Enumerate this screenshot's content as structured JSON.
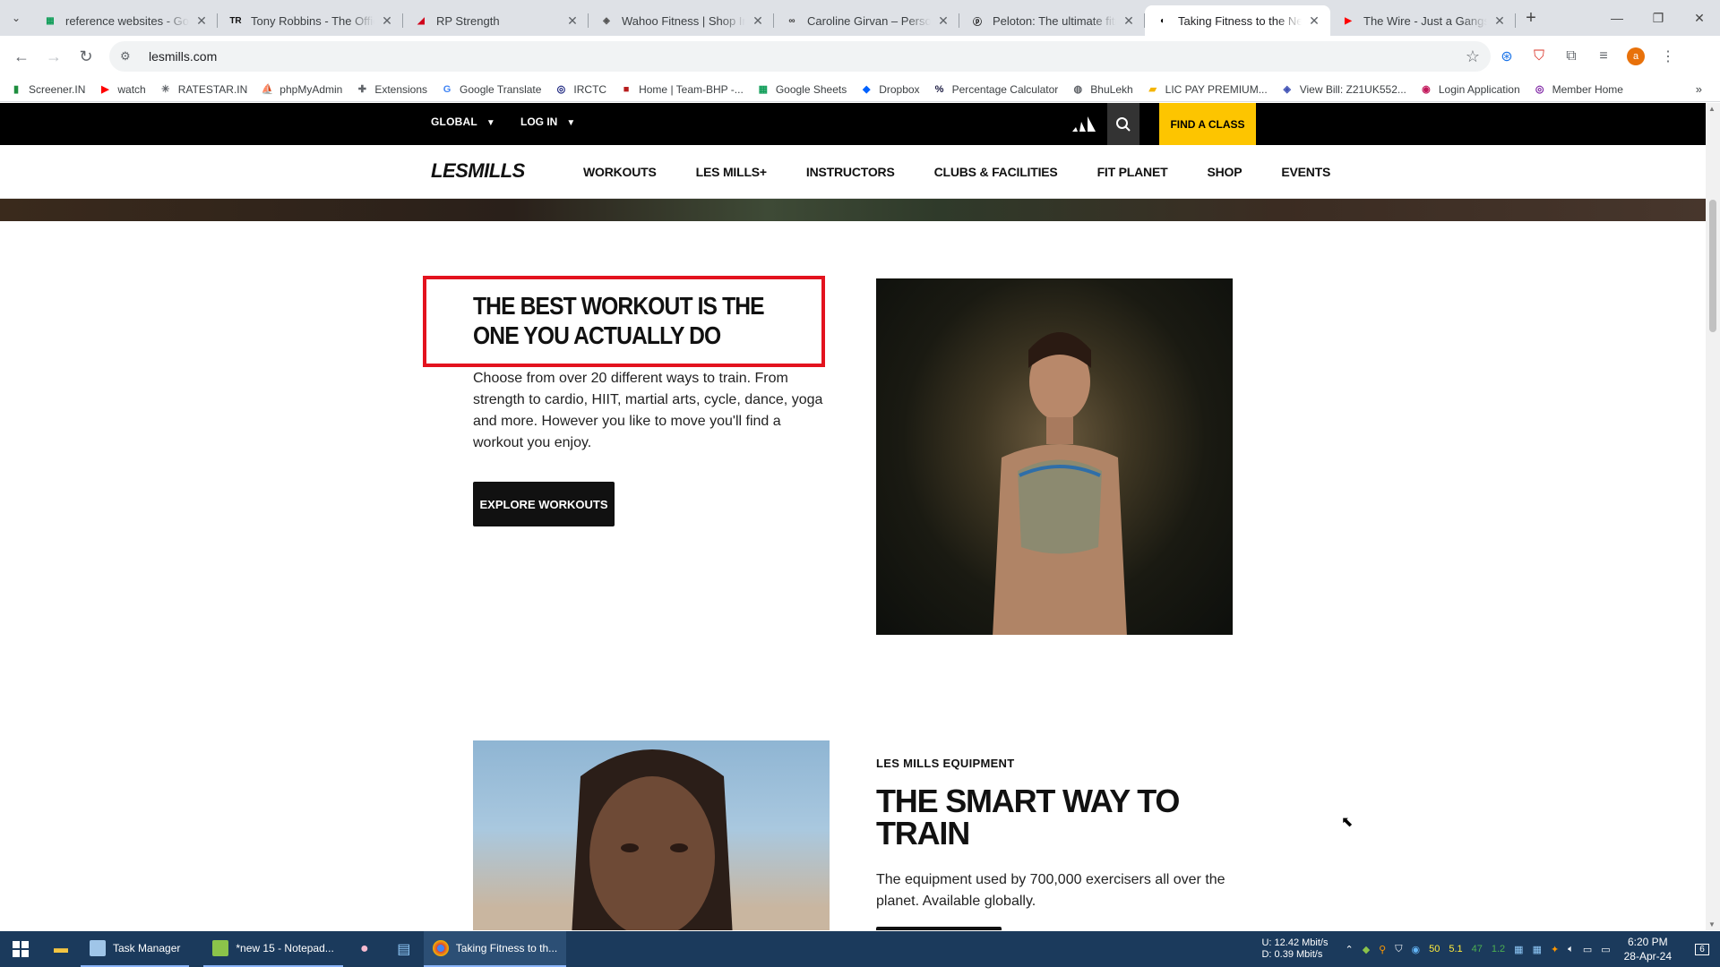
{
  "browser": {
    "tabs": [
      {
        "title": "reference websites - Goog",
        "icon": "sheets-icon",
        "color": "#0f9d58"
      },
      {
        "title": "Tony Robbins - The Officia",
        "icon": "tr-icon",
        "color": "#111111"
      },
      {
        "title": "RP Strength",
        "icon": "rp-icon",
        "color": "#d0021b"
      },
      {
        "title": "Wahoo Fitness | Shop Ind",
        "icon": "wahoo-icon",
        "color": "#555555"
      },
      {
        "title": "Caroline Girvan – Persona",
        "icon": "cg-icon",
        "color": "#333333"
      },
      {
        "title": "Peloton: The ultimate fitn",
        "icon": "peloton-icon",
        "color": "#111111"
      },
      {
        "title": "Taking Fitness to the Next",
        "icon": "lesmills-icon",
        "color": "#000000",
        "active": true
      },
      {
        "title": "The Wire - Just a Gangsta",
        "icon": "youtube-icon",
        "color": "#ff0000"
      }
    ],
    "url": "lesmills.com",
    "bookmarks": [
      {
        "label": "Screener.IN",
        "icon": "bar-chart-icon",
        "color": "#1e8e3e"
      },
      {
        "label": "watch",
        "icon": "youtube-icon",
        "color": "#ff0000"
      },
      {
        "label": "RATESTAR.IN",
        "icon": "ratestar-icon",
        "color": "#5f6368"
      },
      {
        "label": "phpMyAdmin",
        "icon": "phpmyadmin-icon",
        "color": "#f29111"
      },
      {
        "label": "Extensions",
        "icon": "puzzle-icon",
        "color": "#5f6368"
      },
      {
        "label": "Google Translate",
        "icon": "translate-icon",
        "color": "#4285f4"
      },
      {
        "label": "IRCTC",
        "icon": "irctc-icon",
        "color": "#1a237e"
      },
      {
        "label": "Home | Team-BHP -...",
        "icon": "teambhp-icon",
        "color": "#b71c1c"
      },
      {
        "label": "Google Sheets",
        "icon": "sheets-icon",
        "color": "#0f9d58"
      },
      {
        "label": "Dropbox",
        "icon": "dropbox-icon",
        "color": "#0061fe"
      },
      {
        "label": "Percentage Calculator",
        "icon": "percent-icon",
        "color": "#1a1a40"
      },
      {
        "label": "BhuLekh",
        "icon": "globe-icon",
        "color": "#5f6368"
      },
      {
        "label": "LIC PAY PREMIUM...",
        "icon": "lic-icon",
        "color": "#f4b400"
      },
      {
        "label": "View Bill: Z21UK552...",
        "icon": "bill-icon",
        "color": "#3f51b5"
      },
      {
        "label": "Login Application",
        "icon": "login-icon",
        "color": "#c2185b"
      },
      {
        "label": "Member Home",
        "icon": "member-icon",
        "color": "#7b1fa2"
      }
    ]
  },
  "site": {
    "top": {
      "global": "GLOBAL",
      "login": "LOG IN",
      "find_class": "FIND A CLASS"
    },
    "logo": "LESMILLS",
    "nav": [
      "WORKOUTS",
      "LES MILLS+",
      "INSTRUCTORS",
      "CLUBS & FACILITIES",
      "FIT PLANET",
      "SHOP",
      "EVENTS"
    ],
    "block1": {
      "heading": "THE BEST WORKOUT IS THE ONE YOU ACTUALLY DO",
      "body": "Choose from over 20 different ways to train. From strength to cardio, HIIT, martial arts, cycle, dance, yoga and more. However you like to move you'll find a workout you enjoy.",
      "button": "EXPLORE WORKOUTS"
    },
    "block2": {
      "eyebrow": "LES MILLS EQUIPMENT",
      "heading": "THE SMART WAY TO TRAIN",
      "body": "The equipment used by 700,000 exercisers all over the planet. Available globally."
    },
    "accent": "#fdc500",
    "highlight": "#e3131e"
  },
  "taskbar": {
    "apps": [
      {
        "label": "Task Manager",
        "icon": "task-manager-icon"
      },
      {
        "label": "*new 15 - Notepad...",
        "icon": "notepad-icon"
      },
      {
        "label": "Taking Fitness to th...",
        "icon": "chrome-icon"
      }
    ],
    "net_up": "U:   12.42 Mbit/s",
    "net_down": "D:    0.39 Mbit/s",
    "tray_nums": [
      "50",
      "5.1",
      "47",
      "1.2"
    ],
    "time": "6:20 PM",
    "date": "28-Apr-24",
    "notif_count": "6"
  }
}
